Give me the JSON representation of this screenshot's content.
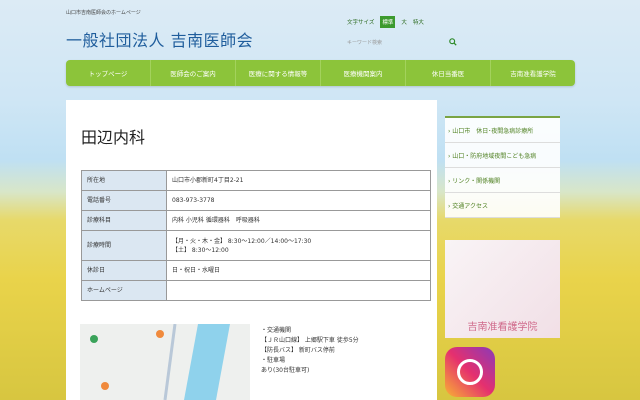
{
  "header": {
    "tagline": "山口市吉南医師会のホームページ",
    "title": "一般社団法人 吉南医師会",
    "font_size_label": "文字サイズ",
    "font_sizes": [
      "標準",
      "大",
      "特大"
    ],
    "search_placeholder": "キーワード検索"
  },
  "nav": [
    "トップページ",
    "医師会のご案内",
    "医療に関する情報等",
    "医療機関案内",
    "休日当番医",
    "吉南准看護学院"
  ],
  "page": {
    "title": "田辺内科",
    "rows": [
      {
        "label": "所在地",
        "value": "山口市小郡新町4丁目2-21"
      },
      {
        "label": "電話番号",
        "value": "083-973-3778"
      },
      {
        "label": "診療科目",
        "value": "内科 小児科 循環器科　呼吸器科"
      },
      {
        "label": "診療時間",
        "value": "【月・火・木・金】 8:30〜12:00／14:00〜17:30",
        "value2": "【土】 8:30〜12:00"
      },
      {
        "label": "休診日",
        "value": "日・祝日・水曜日"
      },
      {
        "label": "ホームページ",
        "value": ""
      }
    ],
    "access": [
      "・交通機関",
      "【ＪＲ山口線】 上郷駅下車 徒歩5分",
      "【防長バス】 新町バス停前",
      "・駐車場",
      "あり(30台駐車可)"
    ]
  },
  "sidebar": [
    "山口市　休日･夜間急病診療所",
    "山口・防府地域夜間こども急病",
    "リンク・関係機関",
    "交通アクセス"
  ],
  "banner": "吉南准看護学院"
}
